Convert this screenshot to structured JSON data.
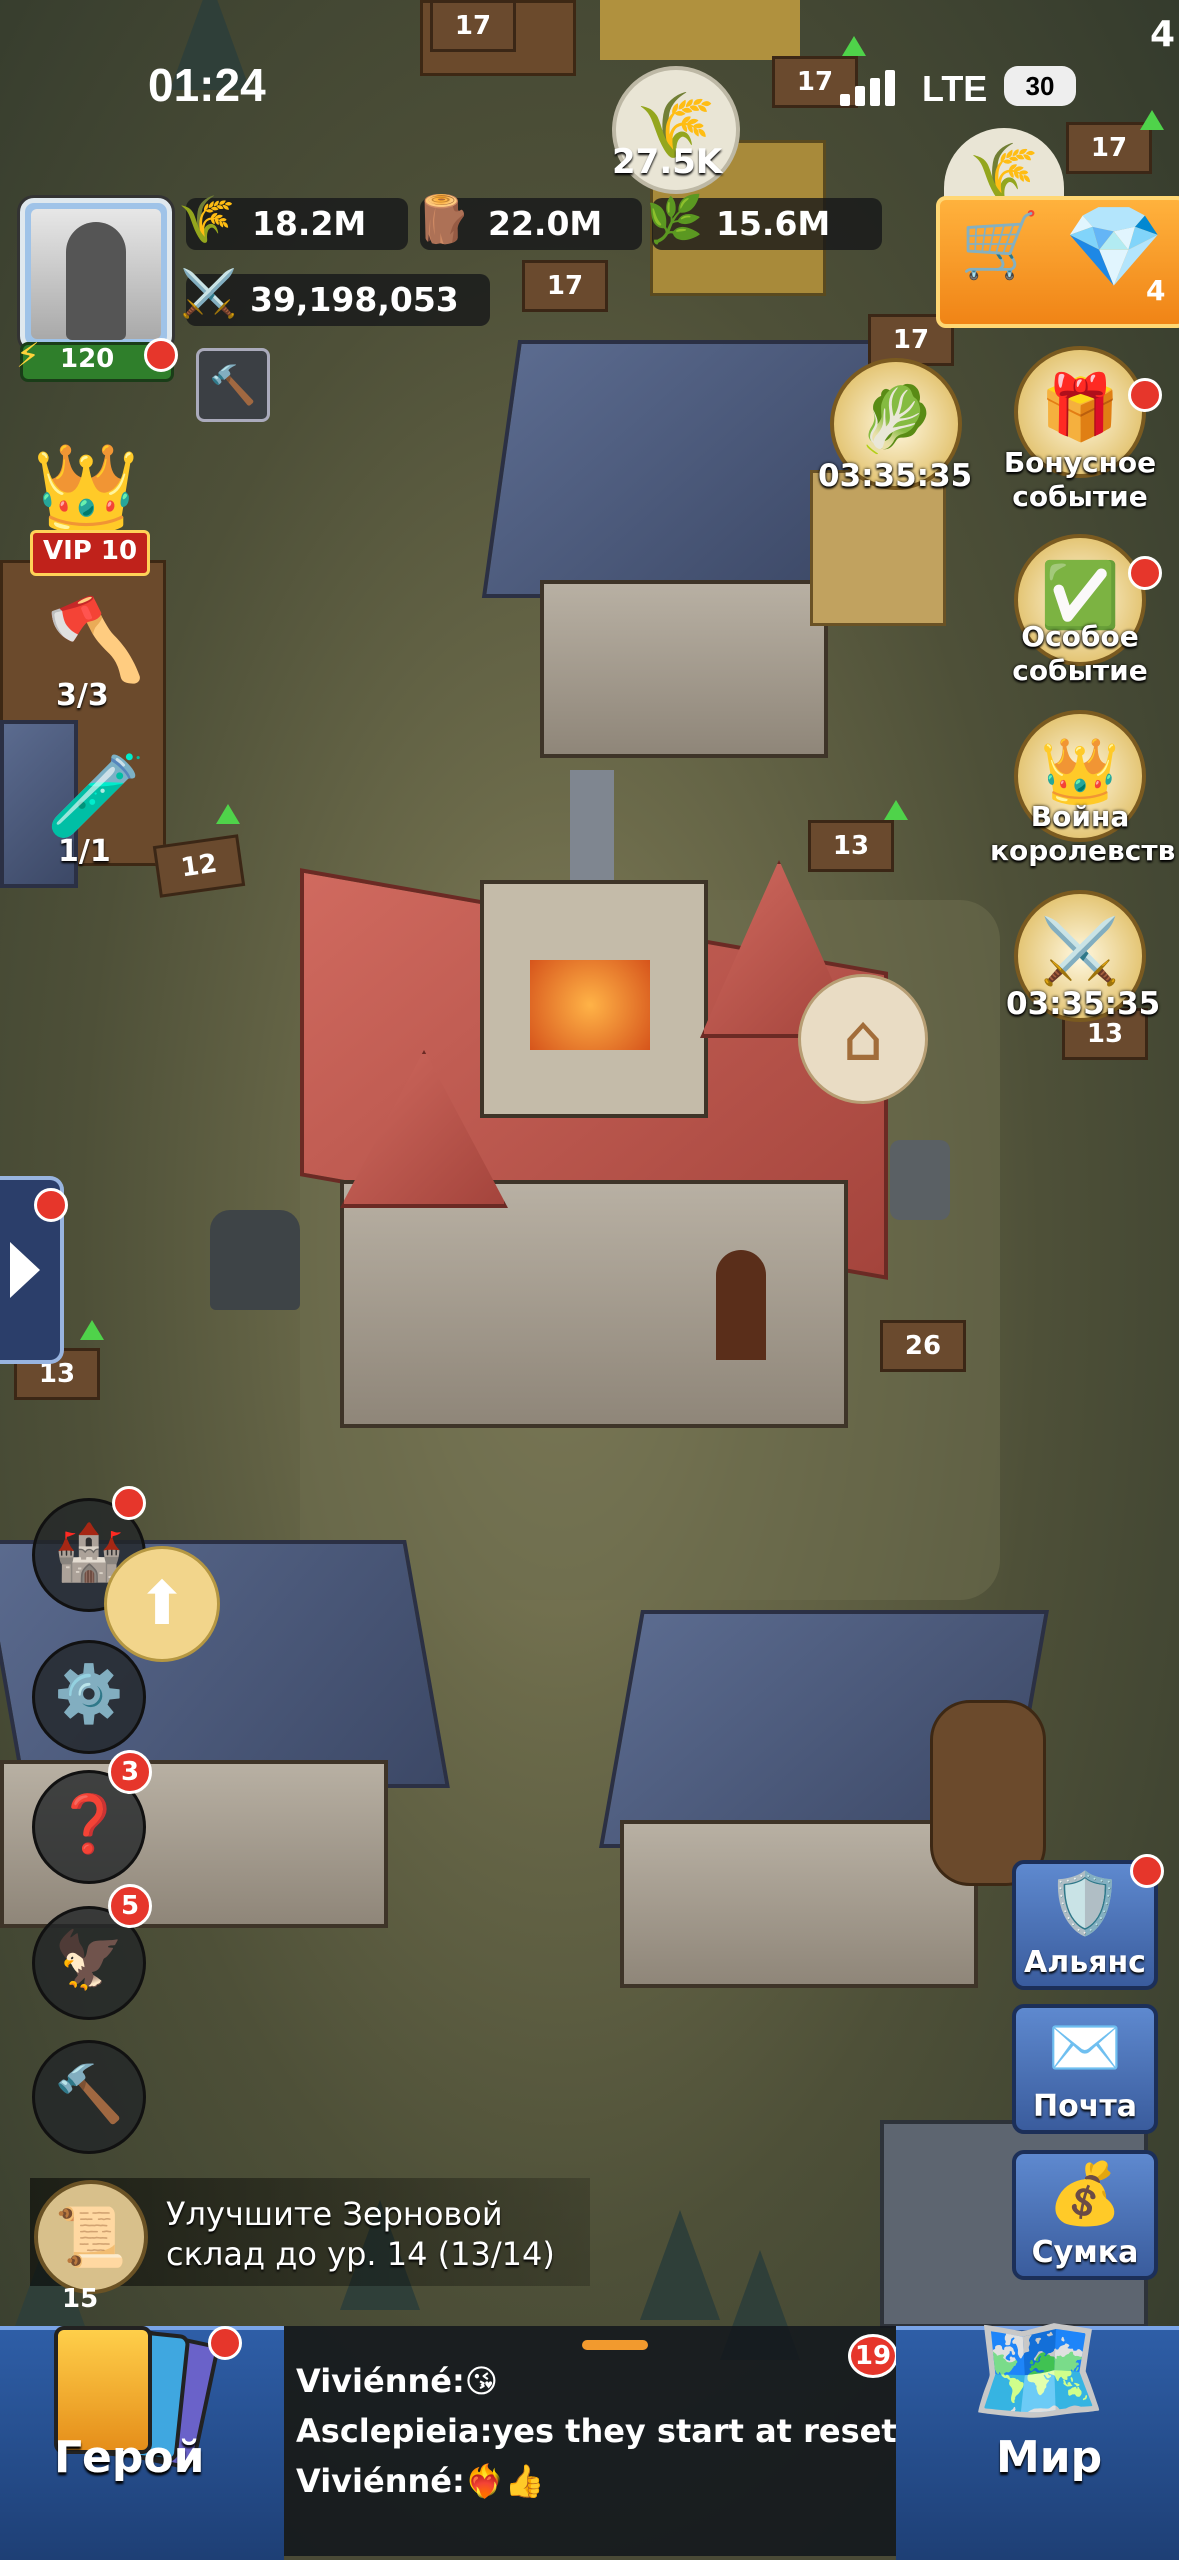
{
  "status_bar": {
    "time": "01:24",
    "network": "LTE",
    "battery": "30"
  },
  "player": {
    "power": "120",
    "vip": "VIP 10"
  },
  "resources": {
    "grain": "18.2M",
    "wood": "22.0M",
    "herb": "15.6M",
    "combat_power": "39,198,053",
    "grain_collect": "27.5K"
  },
  "shop": {
    "count": "4"
  },
  "events": [
    {
      "name": "harvest",
      "timer": "03:35:35"
    },
    {
      "name": "bonus",
      "label": "Бонусное событие"
    },
    {
      "name": "special",
      "label": "Особое событие"
    },
    {
      "name": "kingdom-war",
      "label": "Война королевств"
    },
    {
      "name": "battle",
      "timer": "03:35:35"
    }
  ],
  "left_tools": {
    "builders": "3/3",
    "potions": "1/1",
    "quests_badge": "3",
    "eagle_badge": "5"
  },
  "building_levels": {
    "top_left_a": "17",
    "top_a": "17",
    "top_b": "17",
    "top_right": "17",
    "mid_a": "17",
    "mid_b": "17",
    "left_house": "12",
    "right_house": "13",
    "church": "26",
    "left_edge": "13",
    "right_edge": "13",
    "top_corner": "4",
    "bottom": "15"
  },
  "right_buttons": {
    "alliance": "Альянс",
    "mail": "Почта",
    "bag": "Сумка"
  },
  "quest": {
    "line1": "Улучшите Зерновой",
    "line2": "склад до ур. 14 (13/14)"
  },
  "bottom": {
    "hero": "Герой",
    "world": "Мир",
    "chat_badge": "19",
    "chat": [
      {
        "user": "Viviénné:",
        "text": "😘"
      },
      {
        "user": "Asclepieia:",
        "text": "yes they start at reset"
      },
      {
        "user": "Viviénné:",
        "text": "❤️‍🔥👍"
      }
    ]
  }
}
